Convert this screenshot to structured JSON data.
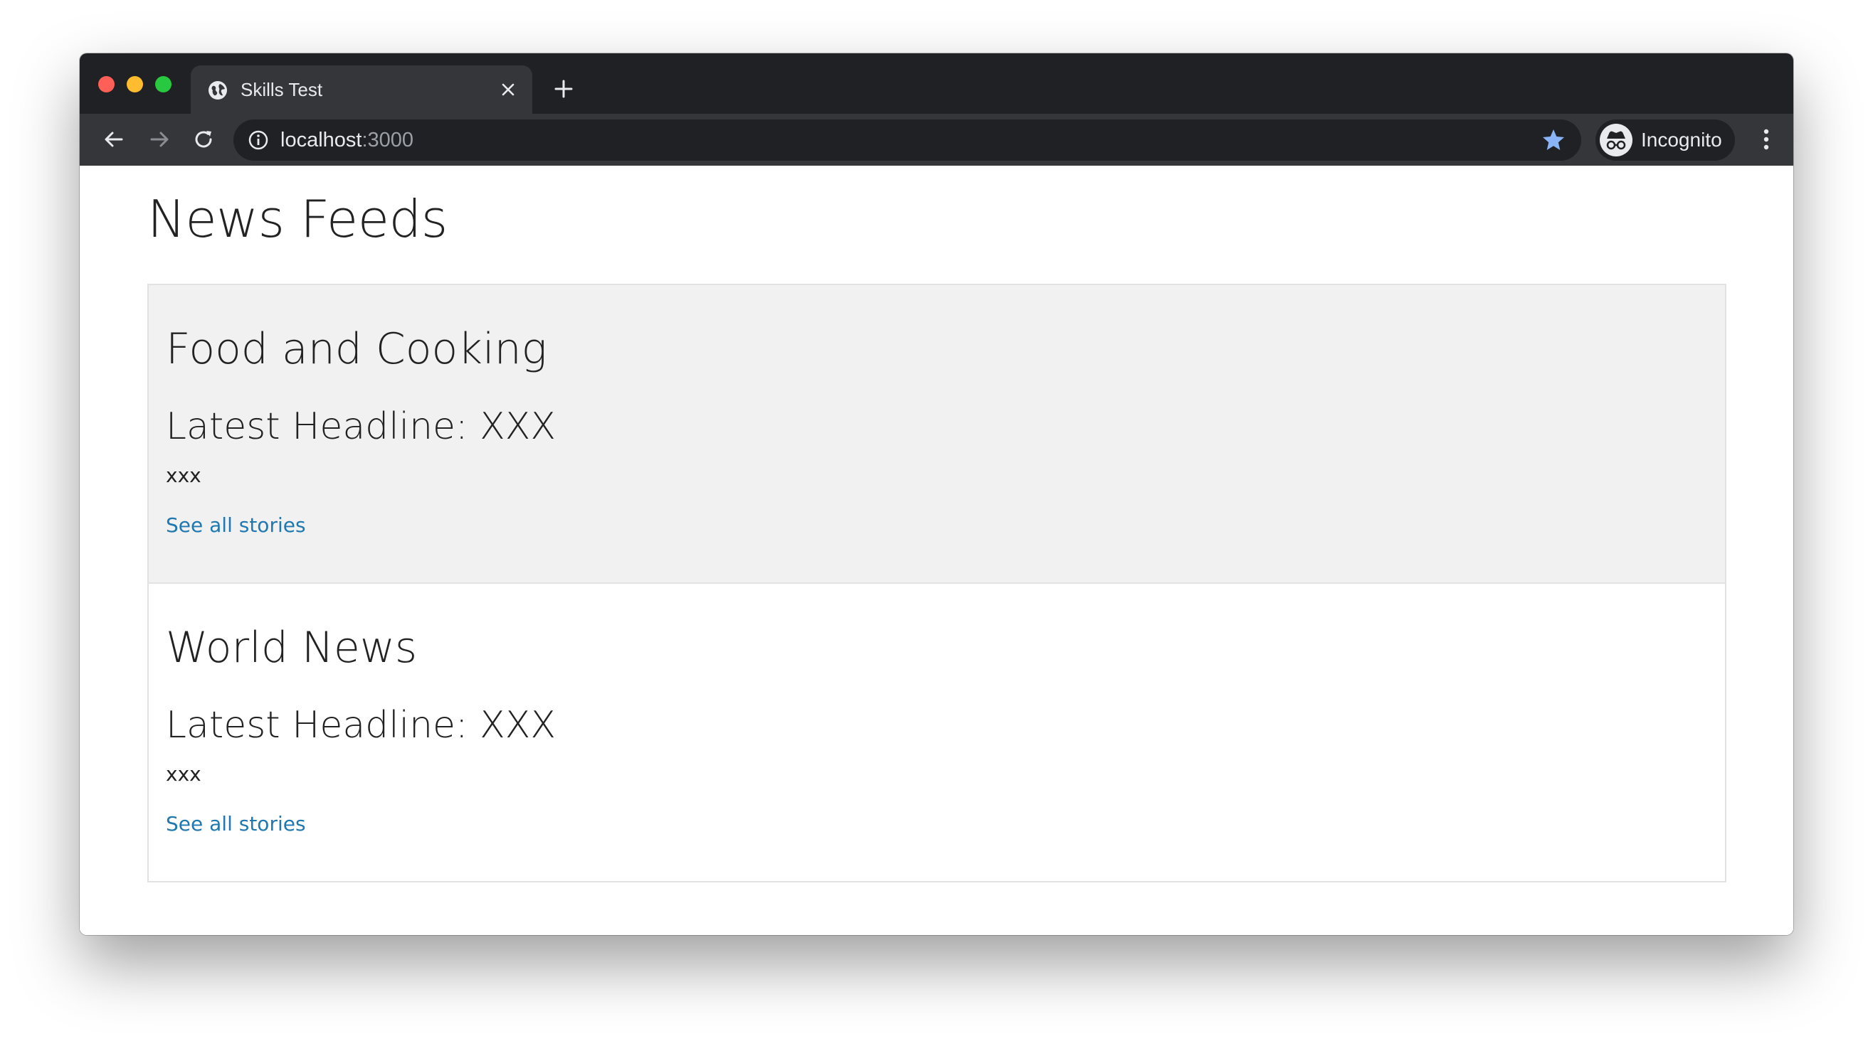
{
  "browser": {
    "tab": {
      "title": "Skills Test"
    },
    "address": {
      "host": "localhost",
      "port": ":3000"
    },
    "profile": {
      "label": "Incognito"
    }
  },
  "page": {
    "title": "News Feeds",
    "feeds": [
      {
        "title": "Food and Cooking",
        "headline": "Latest Headline: XXX",
        "body": "xxx",
        "link": "See all stories"
      },
      {
        "title": "World News",
        "headline": "Latest Headline: XXX",
        "body": "xxx",
        "link": "See all stories"
      }
    ]
  },
  "colors": {
    "link": "#1f78b0",
    "feed_alt_background": "#f1f1f1",
    "bookmark_star": "#8ab4f8"
  }
}
